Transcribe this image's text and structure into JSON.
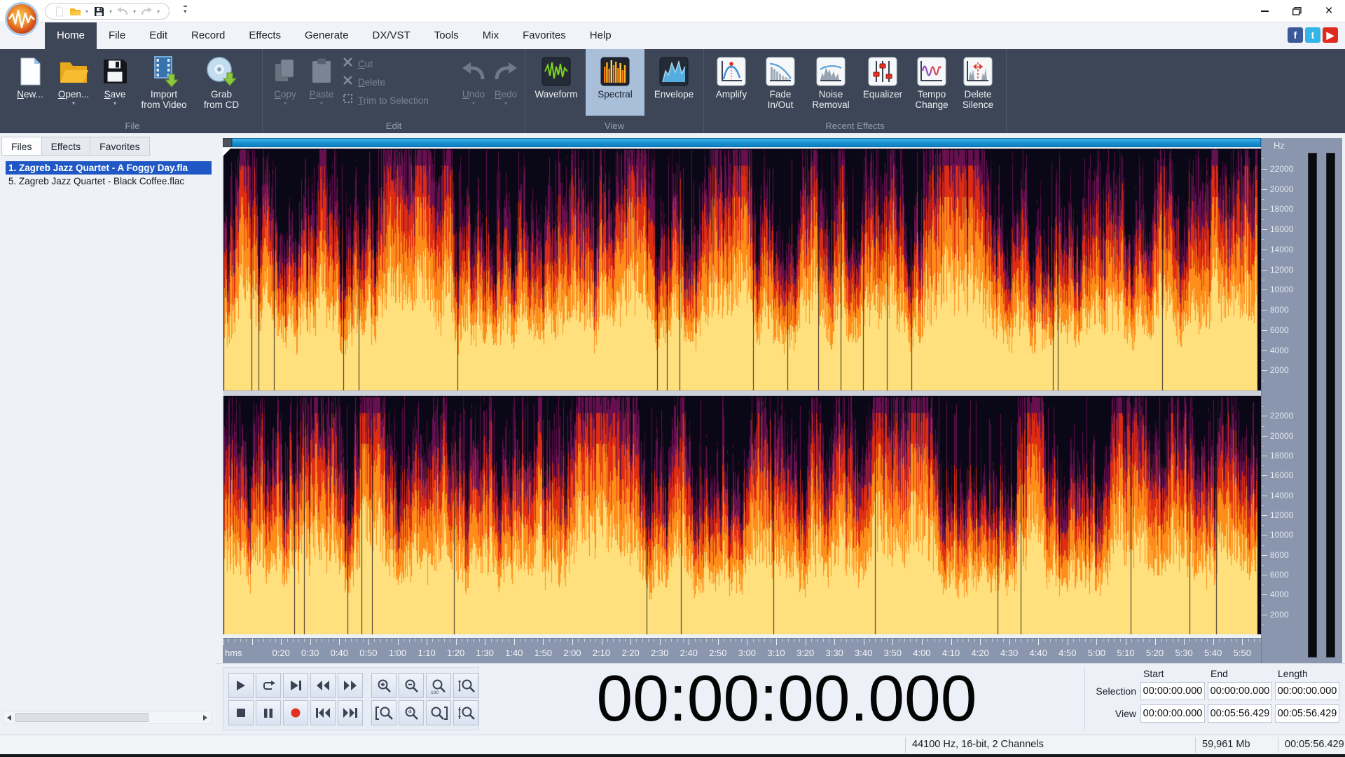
{
  "colors": {
    "accent_blue": "#1a97d5",
    "ribbon_bg": "#3d4656",
    "selected_view_bg": "#a9bed9",
    "selection_blue": "#1f58c4",
    "record_red": "#e23020",
    "facebook": "#3b5998",
    "twitter": "#33b5e5",
    "youtube": "#e02a20"
  },
  "titlebar": {
    "window_controls": {
      "minimize": "minimize",
      "maximize": "maximize",
      "close": "×"
    },
    "quick_access": {
      "new": "new",
      "open": "open",
      "save": "save",
      "undo": "undo",
      "redo": "redo"
    }
  },
  "menu": {
    "tabs": [
      {
        "label": "Home",
        "active": true
      },
      {
        "label": "File"
      },
      {
        "label": "Edit"
      },
      {
        "label": "Record"
      },
      {
        "label": "Effects"
      },
      {
        "label": "Generate"
      },
      {
        "label": "DX/VST"
      },
      {
        "label": "Tools"
      },
      {
        "label": "Mix"
      },
      {
        "label": "Favorites"
      },
      {
        "label": "Help"
      }
    ]
  },
  "social": [
    {
      "name": "facebook",
      "glyph": "f",
      "color": "#3b5998"
    },
    {
      "name": "twitter",
      "glyph": "t",
      "color": "#33b5e5"
    },
    {
      "name": "youtube",
      "glyph": "▶",
      "color": "#e02a20"
    }
  ],
  "ribbon": {
    "groups": {
      "file": {
        "caption": "File",
        "items": [
          {
            "label": "New..."
          },
          {
            "label": "Open..."
          },
          {
            "label": "Save"
          },
          {
            "label1": "Import",
            "label2": "from Video"
          },
          {
            "label1": "Grab",
            "label2": "from CD"
          }
        ]
      },
      "edit": {
        "caption": "Edit",
        "copy": "Copy",
        "paste": "Paste",
        "cut": "Cut",
        "del": "Delete",
        "trim": "Trim to Selection",
        "undo": "Undo",
        "redo": "Redo"
      },
      "view": {
        "caption": "View",
        "items": [
          {
            "label": "Waveform"
          },
          {
            "label": "Spectral",
            "selected": true
          },
          {
            "label": "Envelope"
          }
        ]
      },
      "effects": {
        "caption": "Recent Effects",
        "items": [
          {
            "label1": "Amplify",
            "label2": ""
          },
          {
            "label1": "Fade",
            "label2": "In/Out"
          },
          {
            "label1": "Noise",
            "label2": "Removal"
          },
          {
            "label1": "Equalizer",
            "label2": ""
          },
          {
            "label1": "Tempo",
            "label2": "Change"
          },
          {
            "label1": "Delete",
            "label2": "Silence"
          }
        ]
      }
    }
  },
  "sidebar": {
    "tabs": [
      {
        "label": "Files",
        "active": true
      },
      {
        "label": "Effects"
      },
      {
        "label": "Favorites"
      }
    ],
    "files": [
      {
        "label": "1. Zagreb Jazz Quartet - A Foggy Day.fla",
        "selected": true
      },
      {
        "label": "5. Zagreb Jazz Quartet - Black Coffee.flac"
      }
    ]
  },
  "editor": {
    "freq_unit": "Hz",
    "time_unit": "hms",
    "duration_seconds": 356.429,
    "freq_labels": [
      "22000",
      "20000",
      "18000",
      "16000",
      "14000",
      "12000",
      "10000",
      "8000",
      "6000",
      "4000",
      "2000"
    ],
    "time_labels": [
      "0:20",
      "0:30",
      "0:40",
      "0:50",
      "1:00",
      "1:10",
      "1:20",
      "1:30",
      "1:40",
      "1:50",
      "2:00",
      "2:10",
      "2:20",
      "2:30",
      "2:40",
      "2:50",
      "3:00",
      "3:10",
      "3:20",
      "3:30",
      "3:40",
      "3:50",
      "4:00",
      "4:10",
      "4:20",
      "4:30",
      "4:40",
      "4:50",
      "5:00",
      "5:10",
      "5:20",
      "5:30",
      "5:40",
      "5:50"
    ]
  },
  "transport": {
    "play": "play",
    "loop": "loop",
    "play_to_end": "play-to-end",
    "rewind": "rewind",
    "fast_forward": "fast-forward",
    "stop": "stop",
    "pause": "pause",
    "record": "record",
    "go_to_start": "go-to-start",
    "go_to_end": "go-to-end"
  },
  "zoom_controls": {
    "zoom_in": "zoom-in",
    "zoom_out": "zoom-out",
    "zoom_100": "zoom-to-100",
    "zoom_100_label": "100",
    "zoom_vertical_in": "zoom-vertical-in",
    "zoom_selection_start": "zoom-selection-start",
    "zoom_full": "zoom-full",
    "zoom_selection_end": "zoom-selection-end",
    "zoom_vertical_out": "zoom-vertical-out"
  },
  "time_display": {
    "value": "00:00:00.000"
  },
  "selection_panel": {
    "headers": [
      "Start",
      "End",
      "Length"
    ],
    "rows": [
      {
        "label": "Selection",
        "values": [
          "00:00:00.000",
          "00:00:00.000",
          "00:00:00.000"
        ]
      },
      {
        "label": "View",
        "values": [
          "00:00:00.000",
          "00:05:56.429",
          "00:05:56.429"
        ]
      }
    ]
  },
  "status_bar": {
    "format": "44100 Hz, 16-bit, 2 Channels",
    "size": "59,961 Mb",
    "length": "00:05:56.429"
  }
}
